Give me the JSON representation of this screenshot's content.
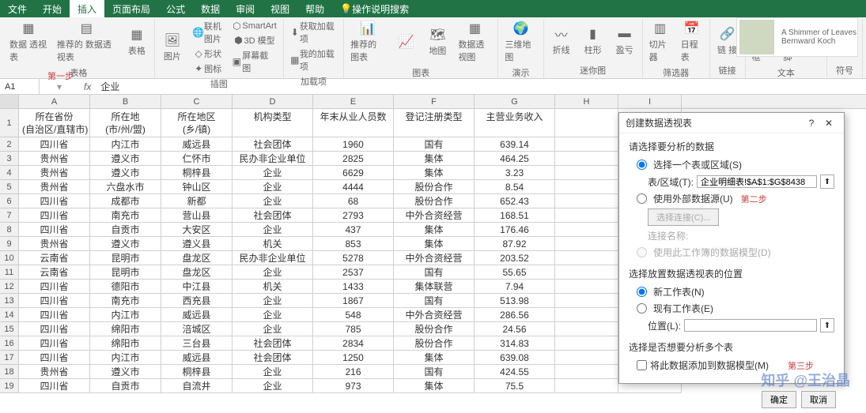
{
  "menu": {
    "file": "文件",
    "home": "开始",
    "insert": "插入",
    "layout": "页面布局",
    "formula": "公式",
    "data": "数据",
    "review": "审阅",
    "view": "视图",
    "help": "帮助",
    "tellme": "操作说明搜索"
  },
  "ribbon": {
    "pivot": "数据\n透视表",
    "recpivot": "推荐的\n数据透视表",
    "table": "表格",
    "pic": "图片",
    "online": "联机图片",
    "shape": "形状",
    "smart": "SmartArt",
    "3d": "3D 模型",
    "screenshot": "屏幕截图",
    "getaddin": "获取加载项",
    "myaddin": "我的加载项",
    "recchart": "推荐的\n图表",
    "chart": "图表",
    "map": "地图",
    "pivotchart": "数据透视图",
    "3dmap": "三维地\n图",
    "spark_line": "折线",
    "spark_col": "柱形",
    "spark_wl": "盈亏",
    "slicer": "切片器",
    "timeline": "日程表",
    "link": "链\n接",
    "textbox": "文本框",
    "headerfooter": "页眉和页脚",
    "symbol": "符\n号",
    "groups": {
      "tables": "表格",
      "illus": "插图",
      "addins": "加载项",
      "charts": "图表",
      "demo": "演示",
      "spark": "迷你图",
      "filter": "筛选器",
      "links": "链接",
      "text": "文本",
      "symbols": "符号"
    }
  },
  "step1": "第一步",
  "step2": "第二步",
  "step3": "第三步",
  "namebox": "A1",
  "fx": "fx",
  "fxval": "企业",
  "cols": [
    "A",
    "B",
    "C",
    "D",
    "E",
    "F",
    "G",
    "H",
    "I"
  ],
  "header1": [
    "所在省份",
    "所在地",
    "所在地区",
    "机构类型",
    "年末从业人员数",
    "登记注册类型",
    "主营业务收入",
    "",
    ""
  ],
  "header2": [
    "(自治区/直辖市)",
    "(市/州/盟)",
    "(乡/镇)",
    "",
    "",
    "",
    "",
    "",
    ""
  ],
  "rows": [
    [
      "四川省",
      "内江市",
      "威远县",
      "社会团体",
      "1960",
      "国有",
      "639.14",
      "",
      ""
    ],
    [
      "贵州省",
      "遵义市",
      "仁怀市",
      "民办非企业单位",
      "2825",
      "集体",
      "464.25",
      "",
      ""
    ],
    [
      "贵州省",
      "遵义市",
      "桐梓县",
      "企业",
      "6629",
      "集体",
      "3.23",
      "",
      ""
    ],
    [
      "贵州省",
      "六盘水市",
      "钟山区",
      "企业",
      "4444",
      "股份合作",
      "8.54",
      "",
      ""
    ],
    [
      "四川省",
      "成都市",
      "新都",
      "企业",
      "68",
      "股份合作",
      "652.43",
      "",
      ""
    ],
    [
      "四川省",
      "南充市",
      "营山县",
      "社会团体",
      "2793",
      "中外合资经营",
      "168.51",
      "",
      ""
    ],
    [
      "四川省",
      "自贡市",
      "大安区",
      "企业",
      "437",
      "集体",
      "176.46",
      "",
      ""
    ],
    [
      "贵州省",
      "遵义市",
      "遵义县",
      "机关",
      "853",
      "集体",
      "87.92",
      "",
      ""
    ],
    [
      "云南省",
      "昆明市",
      "盘龙区",
      "民办非企业单位",
      "5278",
      "中外合资经营",
      "203.52",
      "",
      ""
    ],
    [
      "云南省",
      "昆明市",
      "盘龙区",
      "企业",
      "2537",
      "国有",
      "55.65",
      "",
      ""
    ],
    [
      "四川省",
      "德阳市",
      "中江县",
      "机关",
      "1433",
      "集体联营",
      "7.94",
      "",
      ""
    ],
    [
      "四川省",
      "南充市",
      "西充县",
      "企业",
      "1867",
      "国有",
      "513.98",
      "",
      ""
    ],
    [
      "四川省",
      "内江市",
      "威远县",
      "企业",
      "548",
      "中外合资经营",
      "286.56",
      "",
      ""
    ],
    [
      "四川省",
      "绵阳市",
      "涪城区",
      "企业",
      "785",
      "股份合作",
      "24.56",
      "",
      ""
    ],
    [
      "四川省",
      "绵阳市",
      "三台县",
      "社会团体",
      "2834",
      "股份合作",
      "314.83",
      "",
      ""
    ],
    [
      "四川省",
      "内江市",
      "威远县",
      "社会团体",
      "1250",
      "集体",
      "639.08",
      "",
      ""
    ],
    [
      "贵州省",
      "遵义市",
      "桐梓县",
      "企业",
      "216",
      "国有",
      "424.55",
      "",
      ""
    ],
    [
      "四川省",
      "自贡市",
      "自流井",
      "企业",
      "973",
      "集体",
      "75.5",
      "",
      ""
    ]
  ],
  "dialog": {
    "title": "创建数据透视表",
    "sec1": "请选择要分析的数据",
    "opt1": "选择一个表或区域(S)",
    "tableLabel": "表/区域(T):",
    "tableVal": "企业明细表!$A$1:$G$8438",
    "opt2": "使用外部数据源(U)",
    "chooseConn": "选择连接(C)...",
    "connName": "连接名称:",
    "opt3": "使用此工作簿的数据模型(D)",
    "sec2": "选择放置数据透视表的位置",
    "opt4": "新工作表(N)",
    "opt5": "现有工作表(E)",
    "locLabel": "位置(L):",
    "sec3": "选择是否想要分析多个表",
    "chk1": "将此数据添加到数据模型(M)",
    "ok": "确定",
    "cancel": "取消"
  },
  "card": {
    "title": "A Shimmer of Leaves",
    "author": "Bernward Koch"
  },
  "watermark": "知乎 @王治晶"
}
